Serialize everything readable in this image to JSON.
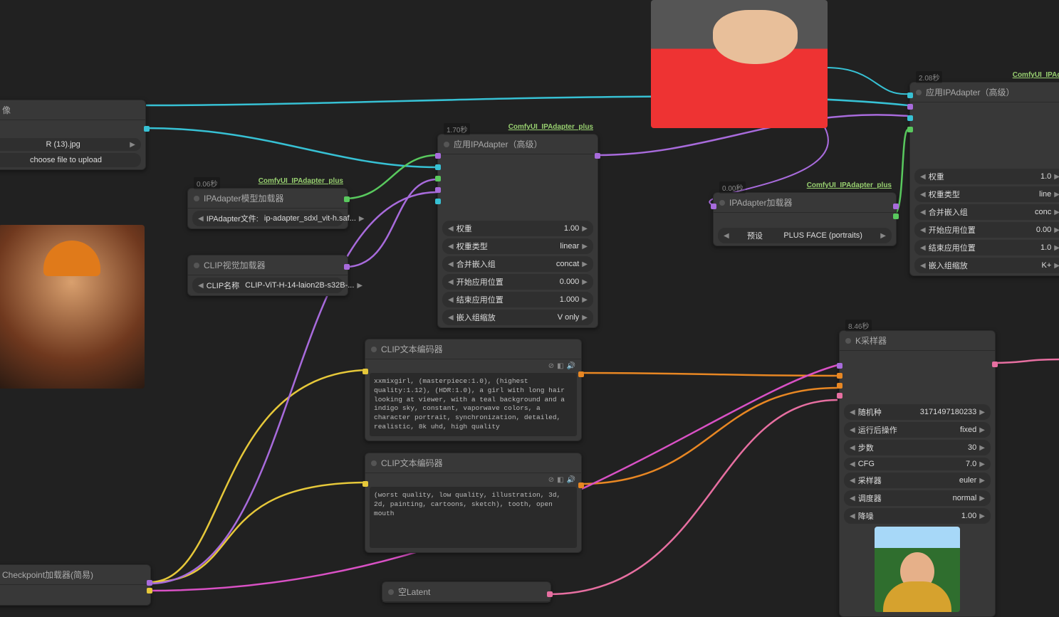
{
  "colors": {
    "bg": "#212121",
    "node": "#383838",
    "accent_green": "#98d070",
    "wire_cyan": "#37c1d4",
    "wire_yellow": "#e6c83a",
    "wire_orange": "#e88723",
    "wire_purple": "#a86bdc",
    "wire_magenta": "#d951c5",
    "wire_pink": "#e76fa1",
    "wire_green": "#59c95e"
  },
  "brand": "ComfyUI_IPAdapter_plus",
  "load_image": {
    "title": "像",
    "filename": "R (13).jpg",
    "upload_btn": "choose file to upload"
  },
  "ipadapter_model_loader": {
    "timing": "0.06秒",
    "title": "IPAdapter模型加载器",
    "param_label": "IPAdapter文件:",
    "param_value": "ip-adapter_sdxl_vit-h.saf..."
  },
  "clip_vision_loader": {
    "title": "CLIP视觉加载器",
    "param_label": "CLIP名称",
    "param_value": "CLIP-ViT-H-14-laion2B-s32B-..."
  },
  "apply_ipadapter": {
    "timing": "1.70秒",
    "title": "应用IPAdapter（高级）",
    "params": [
      {
        "label": "权重",
        "value": "1.00"
      },
      {
        "label": "权重类型",
        "value": "linear"
      },
      {
        "label": "合并嵌入组",
        "value": "concat"
      },
      {
        "label": "开始应用位置",
        "value": "0.000"
      },
      {
        "label": "结束应用位置",
        "value": "1.000"
      },
      {
        "label": "嵌入组缩放",
        "value": "V only"
      }
    ]
  },
  "ipadapter_loader": {
    "timing": "0.00秒",
    "title": "IPAdapter加载器",
    "param_label": "预设",
    "param_value": "PLUS FACE (portraits)"
  },
  "apply_ipadapter2": {
    "timing": "2.08秒",
    "brand": "ComfyUI_IPAda",
    "title": "应用IPAdapter（高级）",
    "params": [
      {
        "label": "权重",
        "value": "1.0"
      },
      {
        "label": "权重类型",
        "value": "line"
      },
      {
        "label": "合并嵌入组",
        "value": "conc"
      },
      {
        "label": "开始应用位置",
        "value": "0.00"
      },
      {
        "label": "结束应用位置",
        "value": "1.0"
      },
      {
        "label": "嵌入组缩放",
        "value": "K+"
      }
    ]
  },
  "clip_text_pos": {
    "title": "CLIP文本编码器",
    "text": "xxmixgirl, (masterpiece:1.0), (highest quality:1.12), (HDR:1.0), a girl with long hair looking at viewer, with a teal background and a indigo sky, constant, vaporwave colors, a character portrait, synchronization, detailed, realistic, 8k uhd, high quality"
  },
  "clip_text_neg": {
    "title": "CLIP文本编码器",
    "text": "(worst quality, low quality, illustration, 3d, 2d, painting, cartoons, sketch), tooth, open mouth"
  },
  "ksampler": {
    "timing": "8.46秒",
    "title": "K采样器",
    "params": [
      {
        "label": "随机种",
        "value": "3171497180233"
      },
      {
        "label": "运行后操作",
        "value": "fixed"
      },
      {
        "label": "步数",
        "value": "30"
      },
      {
        "label": "CFG",
        "value": "7.0"
      },
      {
        "label": "采样器",
        "value": "euler"
      },
      {
        "label": "调度器",
        "value": "normal"
      },
      {
        "label": "降噪",
        "value": "1.00"
      }
    ]
  },
  "checkpoint": {
    "title": "Checkpoint加载器(简易)"
  },
  "empty_latent": {
    "title": "空Latent"
  }
}
